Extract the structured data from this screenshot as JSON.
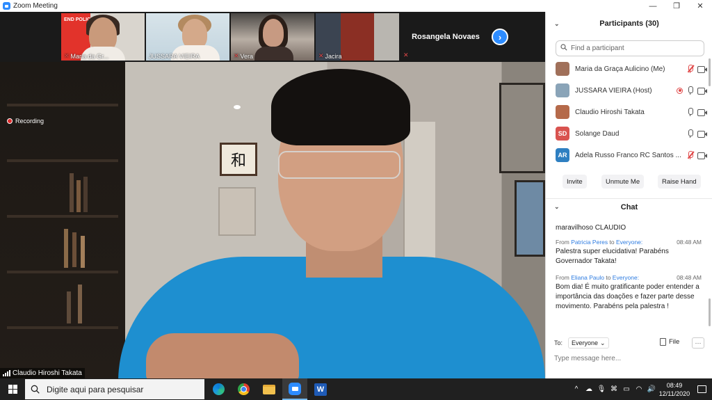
{
  "window": {
    "title": "Zoom Meeting",
    "controls": [
      "—",
      "❐",
      "✕"
    ]
  },
  "gallery": {
    "tiles": [
      {
        "name": "Maria da Gr...",
        "logo_text": "END POLIO NOW"
      },
      {
        "name": "JUSSARA VIEIRA"
      },
      {
        "name": "Vera"
      },
      {
        "name": "Jacira"
      }
    ],
    "speaker_tile": {
      "name": "Rosangela Novaes"
    },
    "next_glyph": "›"
  },
  "main_video": {
    "recording_label": "Recording",
    "speaker_name": "Claudio Hiroshi Takata",
    "frame_glyph": "和"
  },
  "participants": {
    "title": "Participants (30)",
    "search_placeholder": "Find a participant",
    "list": [
      {
        "name": "Maria da Graça Aulicino (Me)",
        "avatar": "",
        "avatar_color": "#a0705a",
        "mic": "muted",
        "rec": false
      },
      {
        "name": "JUSSARA VIEIRA (Host)",
        "avatar": "",
        "avatar_color": "#8aa4b8",
        "mic": "on",
        "rec": true
      },
      {
        "name": "Claudio Hiroshi Takata",
        "avatar": "",
        "avatar_color": "#b56a4a",
        "mic": "on",
        "rec": false
      },
      {
        "name": "Solange Daud",
        "avatar": "SD",
        "avatar_color": "#d9534f",
        "mic": "on",
        "rec": false
      },
      {
        "name": "Adela Russo Franco RC Santos ...",
        "avatar": "AR",
        "avatar_color": "#2e7fc1",
        "mic": "muted",
        "rec": false
      }
    ],
    "buttons": {
      "invite": "Invite",
      "unmute": "Unmute Me",
      "raise_hand": "Raise Hand"
    }
  },
  "chat": {
    "title": "Chat",
    "messages": [
      {
        "from": "",
        "to": "",
        "time": "",
        "text": "maravilhoso CLAUDIO"
      },
      {
        "from_prefix": "From",
        "from": "Patricia Peres",
        "to_word": "to",
        "to": "Everyone:",
        "time": "08:48 AM",
        "text": "Palestra super elucidativa! Parabéns Governador Takata!"
      },
      {
        "from_prefix": "From",
        "from": "Eliana Paulo",
        "to_word": "to",
        "to": "Everyone:",
        "time": "08:48 AM",
        "text": "Bom dia! É muito gratificante poder entender a importância das  doações e fazer parte desse movimento. Parabéns pela palestra !"
      }
    ],
    "to_label": "To:",
    "to_value": "Everyone",
    "file_label": "File",
    "more_label": "···",
    "input_placeholder": "Type message here..."
  },
  "taskbar": {
    "search_placeholder": "Digite aqui para pesquisar",
    "time": "08:49",
    "date": "12/11/2020",
    "tray_chevron": "^"
  },
  "colors": {
    "accent": "#2d8cff",
    "muted": "#e04848",
    "shirt": "#1e8fd0"
  }
}
